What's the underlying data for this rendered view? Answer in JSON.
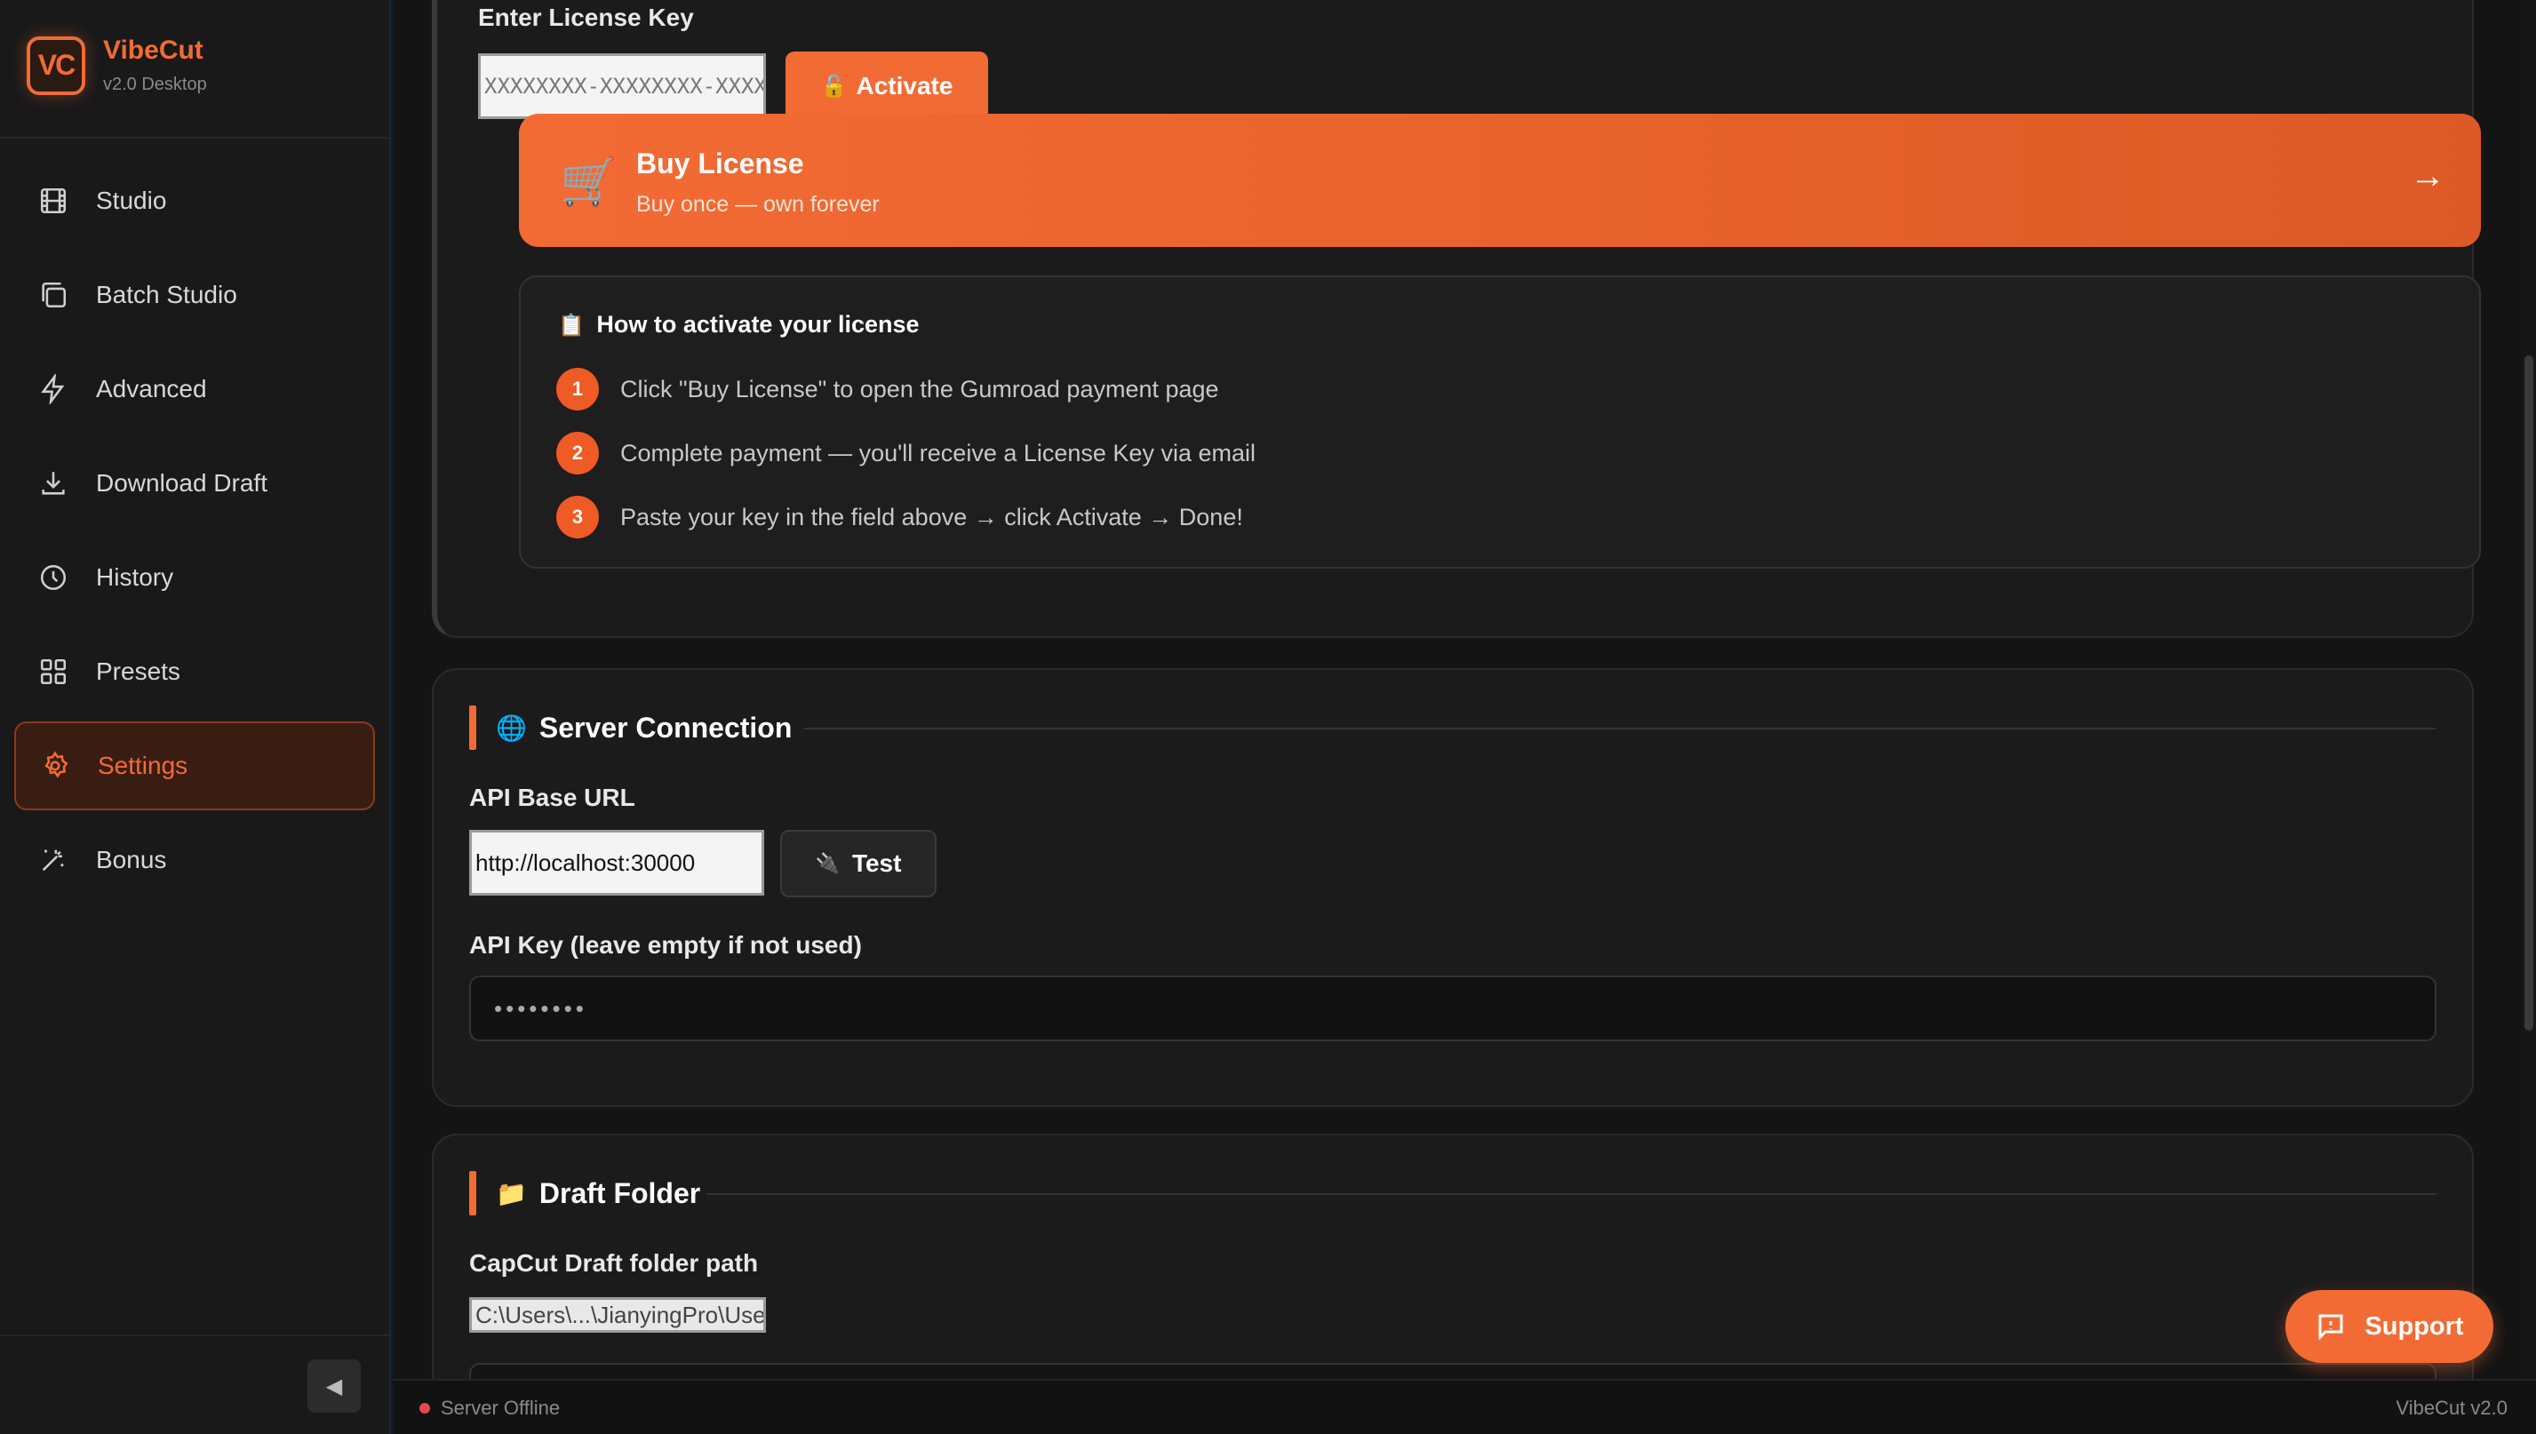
{
  "brand": {
    "logo": "VC",
    "name": "VibeCut",
    "version": "v2.0 Desktop"
  },
  "sidebar": {
    "items": [
      {
        "label": "Studio",
        "icon": "film-icon"
      },
      {
        "label": "Batch Studio",
        "icon": "layers-icon"
      },
      {
        "label": "Advanced",
        "icon": "lightning-icon"
      },
      {
        "label": "Download Draft",
        "icon": "download-icon"
      },
      {
        "label": "History",
        "icon": "clock-icon"
      },
      {
        "label": "Presets",
        "icon": "grid-icon"
      },
      {
        "label": "Settings",
        "icon": "gear-icon",
        "active": true
      },
      {
        "label": "Bonus",
        "icon": "magic-wand-icon"
      }
    ],
    "collapse_glyph": "◀"
  },
  "license": {
    "label": "Enter License Key",
    "placeholder": "XXXXXXXX-XXXXXXXX-XXXXXXXX",
    "activate_icon": "🔓",
    "activate_label": "Activate",
    "buy_icon": "🛒",
    "buy_title": "Buy License",
    "buy_subtitle": "Buy once — own forever",
    "buy_arrow": "→",
    "howto_icon": "📋",
    "howto_title": "How to activate your license",
    "steps": [
      {
        "num": "1",
        "text": "Click \"Buy License\" to open the Gumroad payment page"
      },
      {
        "num": "2",
        "text": "Complete payment — you'll receive a License Key via email"
      },
      {
        "num": "3",
        "text": "Paste your key in the field above → click Activate → Done!"
      }
    ]
  },
  "server": {
    "icon": "🌐",
    "title": "Server Connection",
    "api_base_label": "API Base URL",
    "api_base_value": "http://localhost:30000",
    "test_icon": "🔌",
    "test_label": "Test",
    "api_key_label": "API Key (leave empty if not used)",
    "api_key_value": "••••••••"
  },
  "draft": {
    "icon": "📁",
    "title": "Draft Folder",
    "path_label": "CapCut Draft folder path",
    "path_value": "C:\\Users\\...\\JianyingPro\\User Data\\Projects"
  },
  "status": {
    "text": "Server Offline",
    "color": "#e5484d",
    "version": "VibeCut v2.0"
  },
  "support": {
    "label": "Support"
  },
  "colors": {
    "accent": "#f36b34",
    "background": "#141414",
    "sidebar": "#191919"
  }
}
